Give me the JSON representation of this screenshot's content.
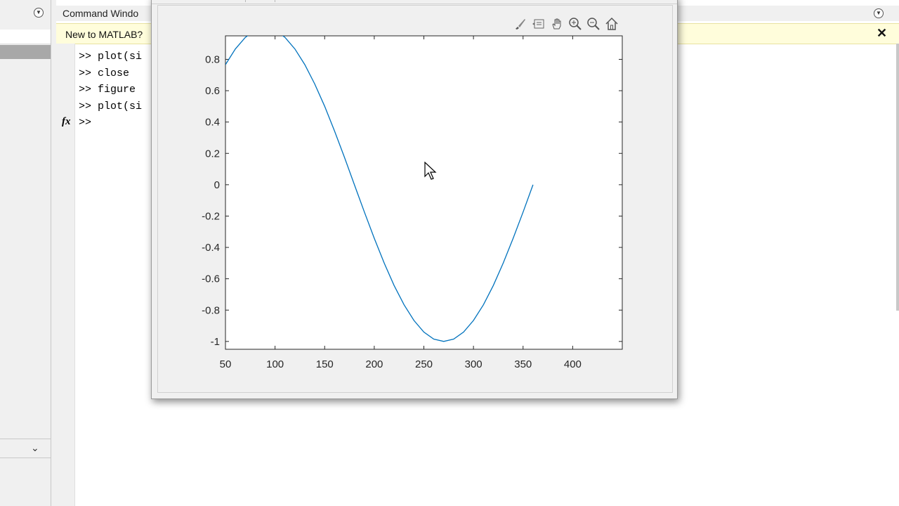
{
  "command_window": {
    "title": "Command Windo",
    "banner": "New to MATLAB?",
    "prompt": ">>",
    "lines": [
      ">> plot(si",
      ">> close",
      ">> figure",
      ">> plot(si",
      ">>"
    ]
  },
  "icons": {
    "left_menu": "chevron-down-circle-icon",
    "cmd_menu": "chevron-down-circle-icon",
    "fx": "fx-icon",
    "banner_close": "close-icon",
    "toolbar": [
      "brush-icon",
      "data-tips-icon",
      "pan-hand-icon",
      "zoom-in-icon",
      "zoom-out-icon",
      "home-icon"
    ]
  },
  "colors": {
    "line": "#0072BD",
    "banner_bg": "#fffddb"
  },
  "chart_data": {
    "type": "line",
    "title": "",
    "xlabel": "",
    "ylabel": "",
    "xlim": [
      50,
      450
    ],
    "ylim": [
      -1.05,
      0.95
    ],
    "x_ticks": [
      50,
      100,
      150,
      200,
      250,
      300,
      350,
      400
    ],
    "y_ticks": [
      0.8,
      0.6,
      0.4,
      0.2,
      0,
      -0.2,
      -0.4,
      -0.6,
      -0.8,
      -1
    ],
    "x_tick_labels": [
      "50",
      "100",
      "150",
      "200",
      "250",
      "300",
      "350",
      "400"
    ],
    "y_tick_labels": [
      "0.8",
      "0.6",
      "0.4",
      "0.2",
      "0",
      "-0.2",
      "-0.4",
      "-0.6",
      "-0.8",
      "-1"
    ],
    "series": [
      {
        "x": [
          50,
          60,
          70,
          80,
          90,
          100,
          110,
          120,
          130,
          140,
          150,
          160,
          170,
          180,
          190,
          200,
          210,
          220,
          230,
          240,
          250,
          260,
          270,
          280,
          290,
          300,
          310,
          320,
          330,
          340,
          350,
          360
        ],
        "y": [
          0.766,
          0.866,
          0.94,
          0.985,
          1.0,
          0.985,
          0.94,
          0.866,
          0.766,
          0.643,
          0.5,
          0.342,
          0.174,
          0.0,
          -0.174,
          -0.342,
          -0.5,
          -0.643,
          -0.766,
          -0.866,
          -0.94,
          -0.985,
          -1.0,
          -0.985,
          -0.94,
          -0.866,
          -0.766,
          -0.643,
          -0.5,
          -0.342,
          -0.174,
          0.0
        ]
      }
    ],
    "grid": false
  }
}
